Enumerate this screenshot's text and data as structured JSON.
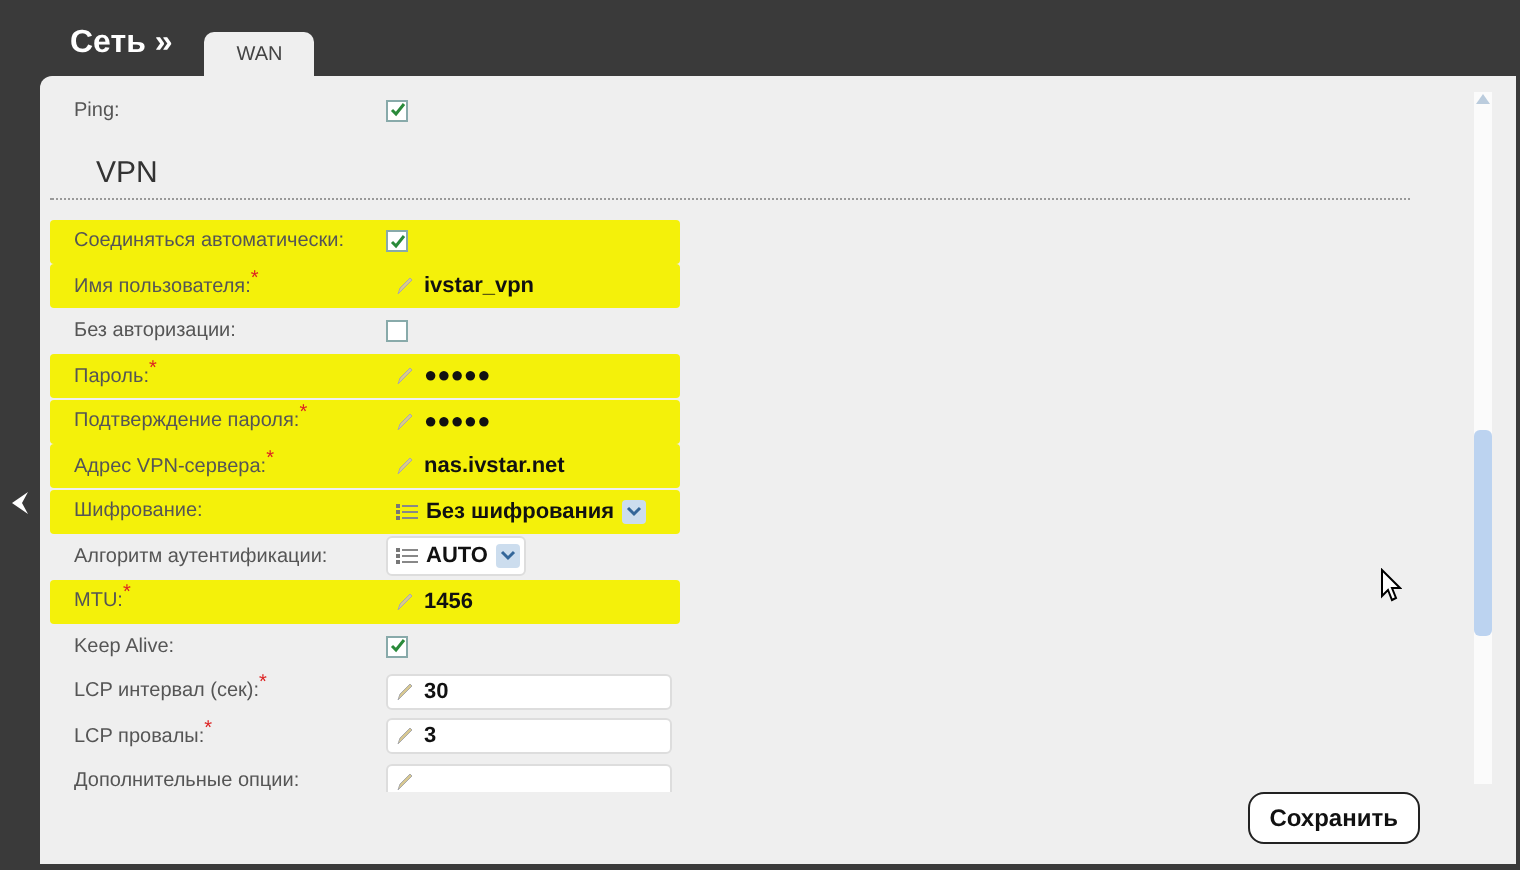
{
  "breadcrumb": "Сеть »",
  "tabs": [
    {
      "label": "WAN",
      "selected": true
    }
  ],
  "top_rows": [
    {
      "kind": "checkbox",
      "label": "Ping:",
      "highlighted": false,
      "checked": true
    }
  ],
  "section": {
    "title": "VPN",
    "rows": [
      {
        "kind": "checkbox",
        "label": "Соединяться автоматически:",
        "highlighted": true,
        "checked": true
      },
      {
        "kind": "text",
        "label": "Имя пользователя:",
        "required_mark": "*",
        "highlighted": true,
        "value": "ivstar_vpn"
      },
      {
        "kind": "checkbox",
        "label": "Без авторизации:",
        "highlighted": false,
        "checked": false
      },
      {
        "kind": "text",
        "label": "Пароль:",
        "required_mark": "*",
        "highlighted": true,
        "value": "●●●●●"
      },
      {
        "kind": "text",
        "label": "Подтверждение пароля:",
        "required_mark": "*",
        "highlighted": true,
        "value": "●●●●●"
      },
      {
        "kind": "text",
        "label": "Адрес VPN-сервера:",
        "required_mark": "*",
        "highlighted": true,
        "value": "nas.ivstar.net"
      },
      {
        "kind": "select",
        "label": "Шифрование:",
        "highlighted": true,
        "value": "Без шифрования"
      },
      {
        "kind": "select",
        "label": "Алгоритм аутентификации:",
        "highlighted": false,
        "value": "AUTO"
      },
      {
        "kind": "text",
        "label": "MTU:",
        "required_mark": "*",
        "highlighted": true,
        "value": "1456"
      },
      {
        "kind": "checkbox",
        "label": "Keep Alive:",
        "highlighted": false,
        "checked": true
      },
      {
        "kind": "text",
        "label": "LCP интервал (сек):",
        "required_mark": "*",
        "highlighted": false,
        "value": "30"
      },
      {
        "kind": "text",
        "label": "LCP провалы:",
        "required_mark": "*",
        "highlighted": false,
        "value": "3"
      },
      {
        "kind": "text",
        "label": "Дополнительные опции:",
        "highlighted": false
      }
    ]
  },
  "save_button": "Сохранить"
}
